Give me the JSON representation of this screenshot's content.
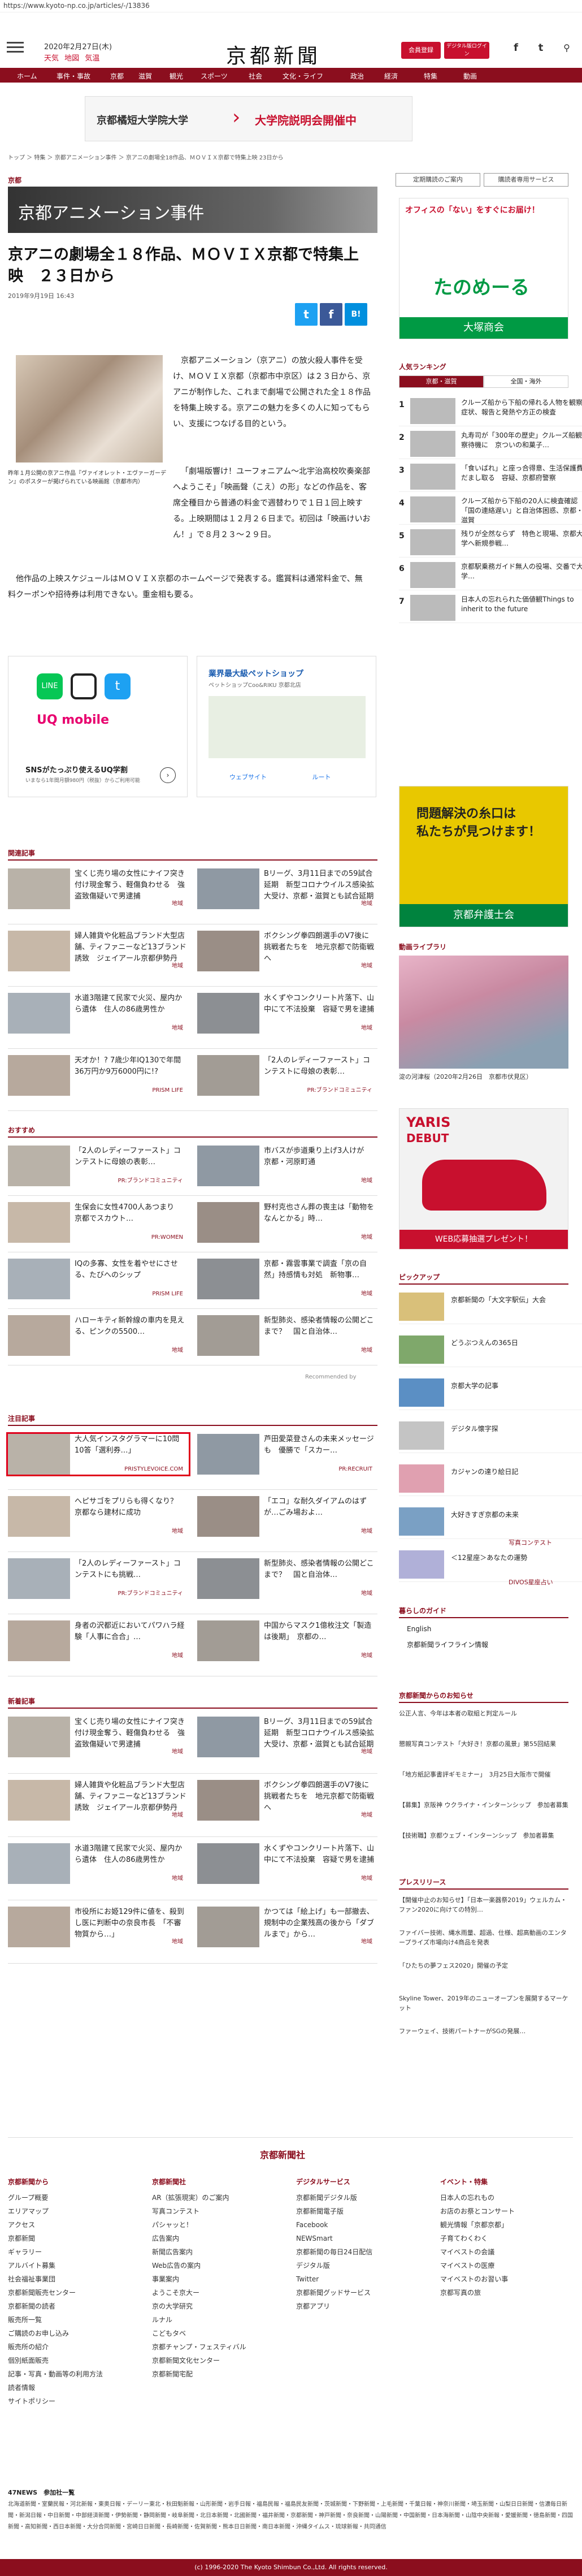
{
  "url": "https://www.kyoto-np.co.jp/articles/-/13836",
  "header": {
    "date": "2020年2月27日(木)",
    "weather": [
      "天気",
      "地図",
      "気温"
    ],
    "logo": "京都新聞",
    "btn_login": "会員登録",
    "btn_digital": "デジタル版ログイン",
    "social": [
      "f",
      "t"
    ]
  },
  "nav": [
    "ホーム",
    "事件・事故",
    "京都",
    "滋賀",
    "観光",
    "スポーツ",
    "社会",
    "文化・ライフ",
    "政治",
    "経済",
    "特集",
    "動画"
  ],
  "banner": {
    "text1": "京都橘短大学院大学",
    "text2": "大学院説明会開催中"
  },
  "breadcrumb": "トップ ＞ 特集 ＞ 京都アニメーション事件 ＞ 京アニの劇場全18作品、ＭＯＶＩＸ京都で特集上映 23日から",
  "top_buttons": [
    "定期購読のご案内",
    "購読者専用サービス"
  ],
  "section": "京都",
  "title_bar": "京都アニメーション事件",
  "article": {
    "headline": "京アニの劇場全１８作品、ＭＯＶＩＸ京都で特集上映　２３日から",
    "date": "2019年9月19日 16:43",
    "photo_caption": "昨年１月公開の京アニ作品『ヴァイオレット・エヴァーガーデン』のポスターが掲げられている映画館（京都市内）",
    "paragraphs": [
      "京都アニメーション（京アニ）の放火殺人事件を受け、ＭＯＶＩＸ京都（京都市中京区）は２３日から、京アニが制作した、これまで劇場で公開された全１８作品を特集上映する。京アニの魅力を多くの人に知ってもらい、支援につなげる目的という。",
      "「劇場版響け！ユーフォニアム～北宇治高校吹奏楽部へようこそ」「映画聲（こえ）の形」などの作品を、客席全種目から普通の料金で週替わりで１日１回上映する。上映期間は１２月２６日まで。初回は「映画けいおん！」で８月２３～２９日。",
      "他作品の上映スケジュールはＭＯＶＩＸ京都のホームページで発表する。鑑賞料は通常料金で、無料クーポンや招待券は利用できない。重金相も要る。"
    ]
  },
  "ad1": {
    "title": "SNSがたっぷり使えるUQ学割",
    "sub": "UQ mobile",
    "desc": "いまなら1年間月額980円（税抜）からご利用可能"
  },
  "ad2": {
    "title": "業界最大級ペットショップ",
    "sub": "ペットショップCoo&RIKU 京都北店",
    "route": "ウェブサイト",
    "nav": "ルート"
  },
  "related_label": "関連記事",
  "related": [
    {
      "t": "宝くじ売り場の女性にナイフ突き付け現金奪う、軽傷負わせる　強盗致傷疑いで男逮捕",
      "s": "地域"
    },
    {
      "t": "Bリーグ、3月11日までの59試合延期　新型コロナウイルス感染拡大受け、京都・滋賀とも試合延期",
      "s": "地域"
    },
    {
      "t": "婦人雑貨や化粧品ブランド大型店舗、ティファニーなど13ブランド誘致　ジェイアール京都伊勢丹",
      "s": "地域"
    },
    {
      "t": "ボクシング拳四朗選手のV7後に　挑戦者たちを　地元京都で防衛戦へ",
      "s": "地域"
    },
    {
      "t": "水道3階建て民家で火災、屋内から遺体　住人の86歳男性か",
      "s": "地域"
    },
    {
      "t": "水くずやコンクリート片落下、山中にて不法投棄　容疑で男を逮捕",
      "s": "地域"
    },
    {
      "t": "天才か！? 7歳少年IQ130で年間36万円か9万6000円に!?",
      "s": "PRISM LIFE"
    },
    {
      "t": "「2人のレディーファースト」コンテストに母娘の表彰…",
      "s": "PR:ブランドコミュニティ"
    }
  ],
  "recommend_label": "おすすめ",
  "recommend": [
    {
      "t": "「2人のレディーファースト」コンテストに母娘の表彰…",
      "s": "PR:ブランドコミュニティ"
    },
    {
      "t": "市バスが歩道乗り上げ3人けが　京都・河原町通",
      "s": "地域"
    },
    {
      "t": "生保会に女性4700人あつまり　京都でスカウト…",
      "s": "PR:WOMEN"
    },
    {
      "t": "野村克也さん葬の喪主は「動物をなんとかる」時…",
      "s": "地域"
    },
    {
      "t": "IQの多寡、女性を着やせにさせる、たびへのシップ",
      "s": "PRISM LIFE"
    },
    {
      "t": "京都・霧雲事業で調査「京の自然」持感情も対処　新物事…",
      "s": "地域"
    },
    {
      "t": "ハローキティ新幹線の車内を見える、ピンクの5500…",
      "s": "地域"
    },
    {
      "t": "新型肺炎、感染者情報の公開どこまで？　国と自治体…",
      "s": "地域"
    }
  ],
  "recommend_credit": "Recommended by",
  "attention_label": "注目記事",
  "attention": [
    {
      "t": "大人気インスタグラマーに10問10答「選利券…」",
      "s": "PRISTYLEVOICE.COM"
    },
    {
      "t": "芦田愛菜登さんの未来メッセージも　優勝で「スカー…",
      "s": "PR:RECRUIT"
    },
    {
      "t": "へピサゴをプリらも得くなり？　京都なら建材に成功",
      "s": "地域"
    },
    {
      "t": "「エコ」な耐久ダイアムのはずが…ごみ場およ…",
      "s": "地域"
    },
    {
      "t": "「2人のレディーファースト」コンテストにも挑戦…",
      "s": "PR:ブランドコミュニティ"
    },
    {
      "t": "新型肺炎、感染者情報の公開どこまで？　国と自治体…",
      "s": "地域"
    },
    {
      "t": "身者の沢都近においてパワハラ経験「人事に合合」…",
      "s": "地域"
    },
    {
      "t": "中国からマスク1億枚注文「製造は後期」　京都の…",
      "s": "地域"
    }
  ],
  "new_label": "新着記事",
  "new": [
    {
      "t": "宝くじ売り場の女性にナイフ突き付け現金奪う、軽傷負わせる　強盗致傷疑いで男逮捕",
      "s": "地域"
    },
    {
      "t": "Bリーグ、3月11日までの59試合延期　新型コロナウイルス感染拡大受け、京都・滋賀とも試合延期",
      "s": "地域"
    },
    {
      "t": "婦人雑貨や化粧品ブランド大型店舗、ティファニーなど13ブランド誘致　ジェイアール京都伊勢丹",
      "s": "地域"
    },
    {
      "t": "ボクシング拳四朗選手のV7後に　挑戦者たちを　地元京都で防衛戦へ",
      "s": "地域"
    },
    {
      "t": "水道3階建て民家で火災、屋内から遺体　住人の86歳男性か",
      "s": "地域"
    },
    {
      "t": "水くずやコンクリート片落下、山中にて不法投棄　容疑で男を逮捕",
      "s": "地域"
    },
    {
      "t": "市役所にお姫129件に値を、殺到し医に判断中の奈良市長　「不審物質から…」",
      "s": "地域"
    },
    {
      "t": "かつては「絵上げ」も一部撤去、規制中の企業残高の後から「ダブルまで」から…",
      "s": "地域"
    }
  ],
  "side_ad_top": {
    "line1": "オフィスの「ない」をすぐにお届け！",
    "line2": "たのめーる",
    "line3": "大塚商会"
  },
  "ranking": {
    "label": "人気ランキング",
    "tabs": [
      "京都・滋賀",
      "全国・海外"
    ],
    "items": [
      {
        "n": "1",
        "t": "クルーズ船から下船の帰れる人物を観察　症状、報告と発熱や方正の検査"
      },
      {
        "n": "2",
        "t": "丸寿司が「300年の歴史」クルーズ船観察待機に　京ついの和菓子…"
      },
      {
        "n": "3",
        "t": "「食いばれ」と座っ合得意、生活保護費だまし取る　容疑、京都府警察"
      },
      {
        "n": "4",
        "t": "クルーズ船から下船の20人に検査確認「国の連絡遅い」と自治体困惑、京都・滋賀"
      },
      {
        "n": "5",
        "t": "残りが全然ならず　特色と現場、京都大学へ新規参戦…"
      },
      {
        "n": "6",
        "t": "京都駅乗務ガイド無人の役場、交番で大学…"
      },
      {
        "n": "7",
        "t": "日本人の忘れられた価値観Things to inherit to the future"
      }
    ]
  },
  "side_ad_lawyer": {
    "line1": "問題解決の糸口は",
    "line2": "私たちが見つけます！",
    "line3": "京都弁護士会"
  },
  "photo_library": {
    "label": "動画ライブラリ",
    "caption": "淀の河津桜（2020年2月26日　京都市伏見区）"
  },
  "side_ad_car": {
    "brand": "YARIS",
    "text": "DEBUT",
    "sub": "WEB応募抽選プレゼント！"
  },
  "pickup_label": "ピックアップ",
  "pickup": [
    {
      "t": "京都新聞の「大文字駅伝」大会"
    },
    {
      "t": "どうぶつえんの365日"
    },
    {
      "t": "京都大学の記事"
    },
    {
      "t": "デジタル懐字探"
    },
    {
      "t": "カジャンの達り絵日記"
    },
    {
      "t": "大好きすぎ京都の未来"
    },
    {
      "t": "＜12星座＞あなたの運勢"
    }
  ],
  "pickup_tags": [
    "写真コンテスト",
    "DIVOS星座占い"
  ],
  "living_label": "暮らしのガイド",
  "living": [
    "English",
    "京都新聞ライフライン情報"
  ],
  "notice_label": "京都新聞からのお知らせ",
  "notice": [
    "公正人言、今年は本者の取組と判定ルール",
    "懇親写真コンテスト「大好き！京都の風景」第55回結果",
    "「地方紙記事書評ギモミナー」　3月25日大阪市で開催",
    "【募集】京阪神 ウクライナ・インターンシップ　参加者募集",
    "【技術職】京都ウェブ・インターンシップ　参加者募集"
  ],
  "press_label": "プレスリリース",
  "press": [
    "【開催中止のお知らせ】「日本一楽器祭2019」ウェルカム・ファン2020に向けての特別…",
    "ファイバー技術、縄水雨量、超過、仕様、超高動画のエンタープライズ市場向け4商品を発表",
    "「ひたちの夢フェス2020」開催の予定",
    "Skyline Tower、2019年のニューオープンを展開するマーケット",
    "ファーウェイ、技術パートナーがSGの発展…"
  ],
  "footer": {
    "logo": "京都新聞社",
    "cols": [
      {
        "h": "京都新聞から",
        "items": [
          "グループ概要",
          "エリアマップ",
          "アクセス",
          "京都新聞",
          "ギャラリー",
          "アルバイト募集",
          "社会福祉事業団",
          "京都新聞販売センター",
          "京都新聞の読者",
          "販売所一覧",
          "ご購読のお申し込み",
          "販売所の紹介",
          "個別紙面販売",
          "記事・写真・動画等の利用方法",
          "読者情報",
          "サイトポリシー"
        ]
      },
      {
        "h": "京都新聞社",
        "items": [
          "AR（拡張現実）のご案内",
          "写真コンテスト",
          "パシャッと！",
          "広告案内",
          "新聞広告案内",
          "Web広告の案内",
          "事業案内",
          "ようこそ京大ー",
          "京の大学研究",
          "ルナル",
          "こどもタベ",
          "京都チャンプ・フェスティバル",
          "京都新聞文化センター",
          "京都新聞宅配"
        ]
      },
      {
        "h": "デジタルサービス",
        "items": [
          "京都新聞デジタル版",
          "京都新聞電子版",
          "Facebook",
          "NEWSmart",
          "京都新聞の毎日24日配信",
          "デジタル版",
          "Twitter",
          "京都新聞グッドサービス",
          "京都アプリ"
        ]
      },
      {
        "h": "イベント・特集",
        "items": [
          "日本人の忘れもの",
          "お店のお祭とコンサート",
          "観光情報「京都京都」",
          "子育てわくわく",
          "マイベストの会議",
          "マイベストの医療",
          "マイベストのお習い事",
          "京都写真の旅"
        ]
      }
    ],
    "tags_label": "47NEWS　参加社一覧",
    "tags": "北海道新聞・室蘭民報・河北新報・東奥日報・デーリー東北・秋田魁新報・山形新聞・岩手日報・福島民報・福島民友新聞・茨城新聞・下野新聞・上毛新聞・千葉日報・神奈川新聞・埼玉新聞・山梨日日新聞・信濃毎日新聞・新潟日報・中日新聞・中部経済新聞・伊勢新聞・静岡新聞・岐阜新聞・北日本新聞・北國新聞・福井新聞・京都新聞・神戸新聞・奈良新聞・山陽新聞・中国新聞・日本海新聞・山陰中央新報・愛媛新聞・徳島新聞・四国新聞・高知新聞・西日本新聞・大分合同新聞・宮崎日日新聞・長崎新聞・佐賀新聞・熊本日日新聞・南日本新聞・沖縄タイムス・琉球新報・共同通信",
    "copyright": "(c) 1996-2020 The Kyoto Shimbun Co.,Ltd. All rights reserved."
  }
}
